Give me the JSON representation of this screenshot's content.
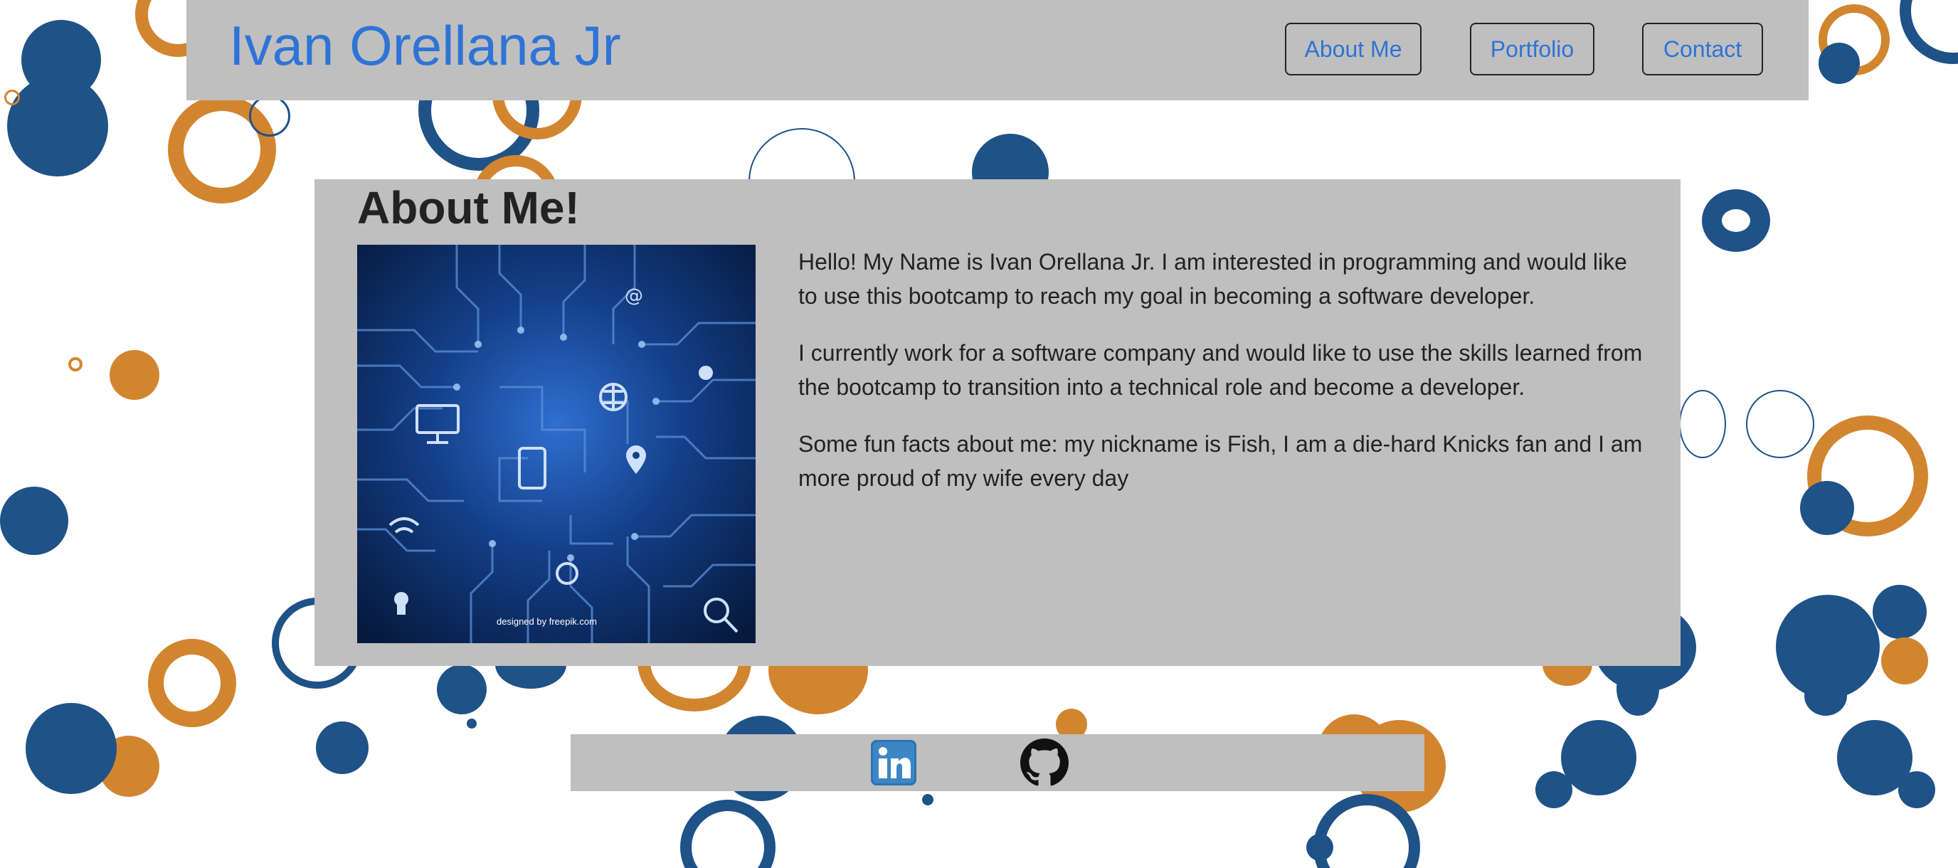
{
  "header": {
    "title": "Ivan Orellana Jr",
    "nav": {
      "about": "About Me",
      "portfolio": "Portfolio",
      "contact": "Contact"
    }
  },
  "about": {
    "heading": "About Me!",
    "image": {
      "credit": "designed by freepik.com"
    },
    "paragraphs": [
      "Hello! My Name is Ivan Orellana Jr. I am interested in programming and would like to use this bootcamp to reach my goal in becoming a software developer.",
      "I currently work for a software company and would like to use the skills learned from the bootcamp to transition into a technical role and become a developer.",
      "Some fun facts about me: my nickname is Fish, I am a die-hard Knicks fan and I am more proud of my wife every day"
    ]
  },
  "footer": {
    "links": [
      {
        "icon": "linkedin-icon"
      },
      {
        "icon": "github-icon"
      }
    ]
  },
  "colors": {
    "accent_blue": "#2f73d6",
    "panel_gray": "#bfbfbf",
    "circle_blue": "#1f5287",
    "circle_orange": "#d2852f"
  }
}
